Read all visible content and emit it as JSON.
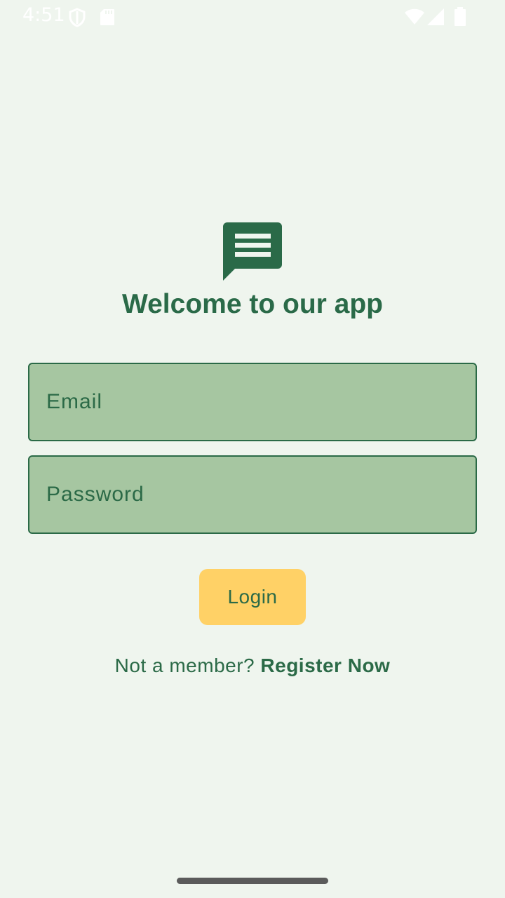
{
  "status_bar": {
    "time": "4:51",
    "left_icons": [
      "shield-icon",
      "sd-card-icon"
    ],
    "right_icons": [
      "wifi-icon",
      "signal-icon",
      "battery-icon"
    ]
  },
  "logo": {
    "icon": "message-icon",
    "color": "#2a6a48"
  },
  "title": "Welcome to our app",
  "form": {
    "email": {
      "placeholder": "Email",
      "value": ""
    },
    "password": {
      "placeholder": "Password",
      "value": ""
    },
    "login_label": "Login"
  },
  "register": {
    "prompt": "Not a member?",
    "link_label": "Register Now"
  },
  "colors": {
    "background": "#eff5ee",
    "primary": "#2a6a48",
    "field_fill": "#a6c6a1",
    "accent": "#ffd166"
  }
}
